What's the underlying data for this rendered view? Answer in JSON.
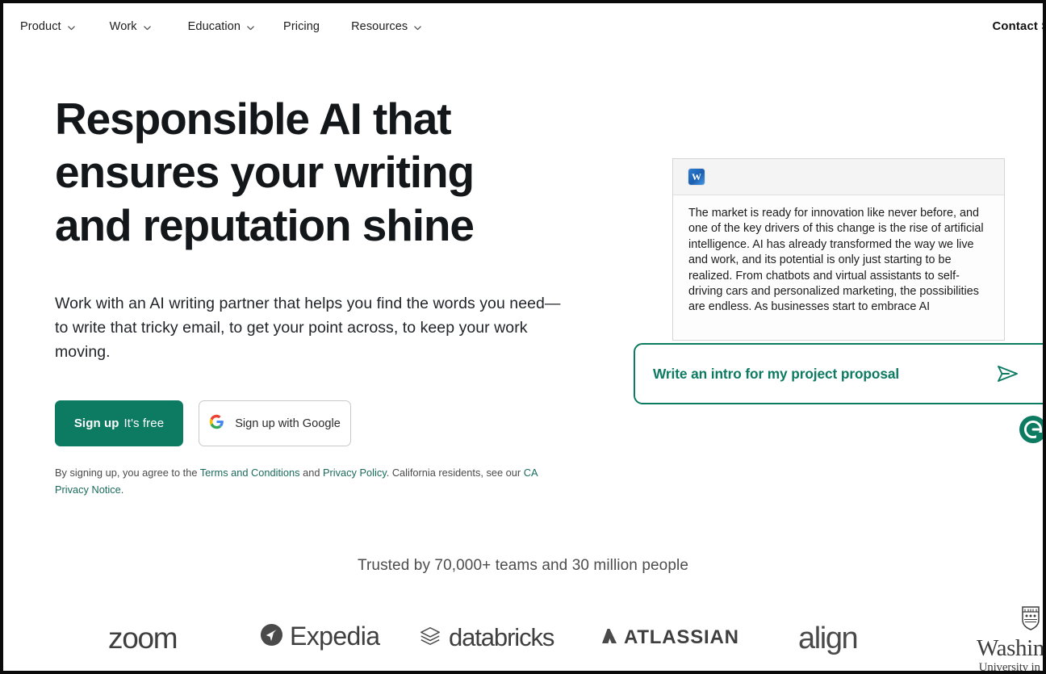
{
  "nav": {
    "items": [
      {
        "label": "Product",
        "has_dropdown": true,
        "icon": "chevron-down-icon"
      },
      {
        "label": "Work",
        "has_dropdown": true,
        "icon": "chevron-down-icon"
      },
      {
        "label": "Education",
        "has_dropdown": true,
        "icon": "chevron-down-icon"
      },
      {
        "label": "Pricing",
        "has_dropdown": false,
        "icon": ""
      },
      {
        "label": "Resources",
        "has_dropdown": true,
        "icon": "chevron-down-icon"
      }
    ],
    "contact_sales": "Contact Sales"
  },
  "hero": {
    "headline": "Responsible AI that ensures your writing and reputation shine",
    "subhead": "Work with an AI writing partner that helps you find the words you need—to write that tricky email, to get your point across, to keep your work moving.",
    "signup_bold": "Sign up",
    "signup_normal": "It's free",
    "google_button": "Sign up with Google",
    "google_icon": "google-g-icon",
    "legal": {
      "part1": "By signing up, you agree to the ",
      "link_terms": "Terms and Conditions",
      "part2": " and ",
      "link_privacy": "Privacy Policy",
      "part3": ". California residents, see our ",
      "link_ca": "CA Privacy Notice",
      "part4": "."
    }
  },
  "doc_mock": {
    "app_icon": "microsoft-word-icon",
    "body_text": "The market is ready for innovation like never before, and one of the key drivers of this change is the rise of artificial intelligence. AI has already transformed the way we live and work, and its potential is only just starting to be realized. From chatbots and virtual assistants to self-driving cars and personalized marketing, the possibilities are endless. As businesses start to embrace AI"
  },
  "prompt": {
    "text": "Write an intro for my project proposal",
    "send_icon": "send-arrow-icon",
    "badge_icon": "grammarly-g-icon",
    "accent_color": "#0d7a62"
  },
  "social_proof": {
    "trusted_text": "Trusted by 70,000+ teams and 30 million people",
    "logos": [
      {
        "name": "zoom",
        "text": "zoom"
      },
      {
        "name": "expedia",
        "text": "Expedia"
      },
      {
        "name": "databricks",
        "text": "databricks"
      },
      {
        "name": "atlassian",
        "text": "ATLASSIAN"
      },
      {
        "name": "align",
        "text": "align"
      },
      {
        "name": "washu_line1",
        "text": "Washington"
      },
      {
        "name": "washu_line2",
        "text": "University in St.Louis"
      }
    ]
  }
}
